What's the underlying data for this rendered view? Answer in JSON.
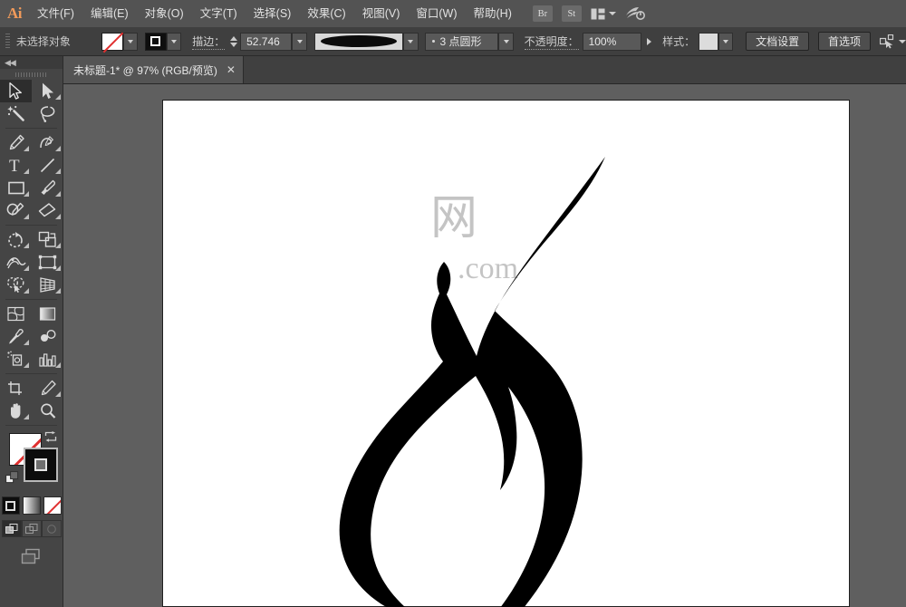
{
  "app": {
    "name": "Adobe Illustrator",
    "logo_text": "Ai"
  },
  "menubar": {
    "items": [
      {
        "label": "文件(F)",
        "name": "menu-file"
      },
      {
        "label": "编辑(E)",
        "name": "menu-edit"
      },
      {
        "label": "对象(O)",
        "name": "menu-object"
      },
      {
        "label": "文字(T)",
        "name": "menu-type"
      },
      {
        "label": "选择(S)",
        "name": "menu-select"
      },
      {
        "label": "效果(C)",
        "name": "menu-effect"
      },
      {
        "label": "视图(V)",
        "name": "menu-view"
      },
      {
        "label": "窗口(W)",
        "name": "menu-window"
      },
      {
        "label": "帮助(H)",
        "name": "menu-help"
      }
    ],
    "bridge_label": "Br",
    "stock_label": "St",
    "arrange_icon": "arrange-documents-icon",
    "sync_icon": "sync-settings-icon"
  },
  "controlbar": {
    "selection_status": "未选择对象",
    "fill_icon": "fill-none-swatch",
    "stroke_icon": "stroke-black-swatch",
    "stroke_label": "描边：",
    "stroke_weight": "52.746",
    "stroke_profile_icon": "width-profile-lens",
    "stroke_style": "3 点圆形",
    "opacity_label": "不透明度：",
    "opacity_value": "100%",
    "style_label": "样式：",
    "doc_setup_button": "文档设置",
    "preferences_button": "首选项",
    "select_similar_icon": "select-similar-objects-icon"
  },
  "tabbar": {
    "tab_title": "未标题-1* @ 97% (RGB/预览)",
    "close_glyph": "✕"
  },
  "tools": {
    "collapse_glyph": "◀◀",
    "groups": [
      [
        {
          "name": "tool-selection",
          "label": "选择工具",
          "active": true,
          "more": false
        },
        {
          "name": "tool-direct-selection",
          "label": "直接选择工具",
          "active": false,
          "more": true
        },
        {
          "name": "tool-magic-wand",
          "label": "魔棒工具",
          "active": false,
          "more": false
        },
        {
          "name": "tool-lasso",
          "label": "套索工具",
          "active": false,
          "more": false
        }
      ],
      [
        {
          "name": "tool-pen",
          "label": "钢笔工具",
          "active": false,
          "more": true
        },
        {
          "name": "tool-curvature",
          "label": "曲率工具",
          "active": false,
          "more": false
        },
        {
          "name": "tool-type",
          "label": "文字工具",
          "active": false,
          "more": true
        },
        {
          "name": "tool-line-segment",
          "label": "直线段工具",
          "active": false,
          "more": true
        },
        {
          "name": "tool-rectangle",
          "label": "矩形工具",
          "active": false,
          "more": true
        },
        {
          "name": "tool-paintbrush",
          "label": "画笔工具",
          "active": false,
          "more": true
        },
        {
          "name": "tool-pencil",
          "label": "铅笔工具",
          "active": false,
          "more": true
        },
        {
          "name": "tool-eraser",
          "label": "橡皮擦工具",
          "active": false,
          "more": true
        }
      ],
      [
        {
          "name": "tool-rotate",
          "label": "旋转工具",
          "active": false,
          "more": true
        },
        {
          "name": "tool-scale",
          "label": "比例缩放工具",
          "active": false,
          "more": true
        },
        {
          "name": "tool-width",
          "label": "宽度工具",
          "active": false,
          "more": true
        },
        {
          "name": "tool-free-transform",
          "label": "自由变换工具",
          "active": false,
          "more": true
        },
        {
          "name": "tool-shape-builder",
          "label": "形状生成器工具",
          "active": false,
          "more": true
        },
        {
          "name": "tool-perspective-grid",
          "label": "透视网格工具",
          "active": false,
          "more": true
        }
      ],
      [
        {
          "name": "tool-mesh",
          "label": "网格工具",
          "active": false,
          "more": false
        },
        {
          "name": "tool-gradient",
          "label": "渐变工具",
          "active": false,
          "more": false
        },
        {
          "name": "tool-eyedropper",
          "label": "吸管工具",
          "active": false,
          "more": true
        },
        {
          "name": "tool-blend",
          "label": "混合工具",
          "active": false,
          "more": false
        },
        {
          "name": "tool-symbol-sprayer",
          "label": "符号喷枪工具",
          "active": false,
          "more": true
        },
        {
          "name": "tool-column-graph",
          "label": "柱形图工具",
          "active": false,
          "more": true
        }
      ],
      [
        {
          "name": "tool-artboard",
          "label": "画板工具",
          "active": false,
          "more": false
        },
        {
          "name": "tool-slice",
          "label": "切片工具",
          "active": false,
          "more": true
        },
        {
          "name": "tool-hand",
          "label": "抓手工具",
          "active": false,
          "more": true
        },
        {
          "name": "tool-zoom",
          "label": "缩放工具",
          "active": false,
          "more": false
        }
      ]
    ],
    "fill_stroke": {
      "fill_icon": "fill-none-large-swatch",
      "stroke_icon": "stroke-black-large-swatch",
      "swap_icon": "swap-fill-stroke-icon",
      "default_icon": "default-fill-stroke-icon",
      "modes": [
        {
          "name": "fill-mode-color",
          "label": "颜色"
        },
        {
          "name": "fill-mode-gradient",
          "label": "渐变"
        },
        {
          "name": "fill-mode-none",
          "label": "无"
        }
      ],
      "draw_modes": [
        {
          "name": "draw-normal-mode",
          "label": "正常绘图",
          "active": true
        },
        {
          "name": "draw-behind-mode",
          "label": "背面绘图",
          "active": false
        },
        {
          "name": "draw-inside-mode",
          "label": "内部绘图",
          "active": false
        }
      ],
      "screen_mode_icon": "change-screen-mode-icon"
    }
  },
  "canvas": {
    "artwork_name": "flame-bird-silhouette",
    "artwork_fill_color": "#000000",
    "artboard_background": "#ffffff",
    "canvas_background": "#5f5f5f",
    "watermark": {
      "line1": "网",
      "line2": ".com"
    }
  }
}
